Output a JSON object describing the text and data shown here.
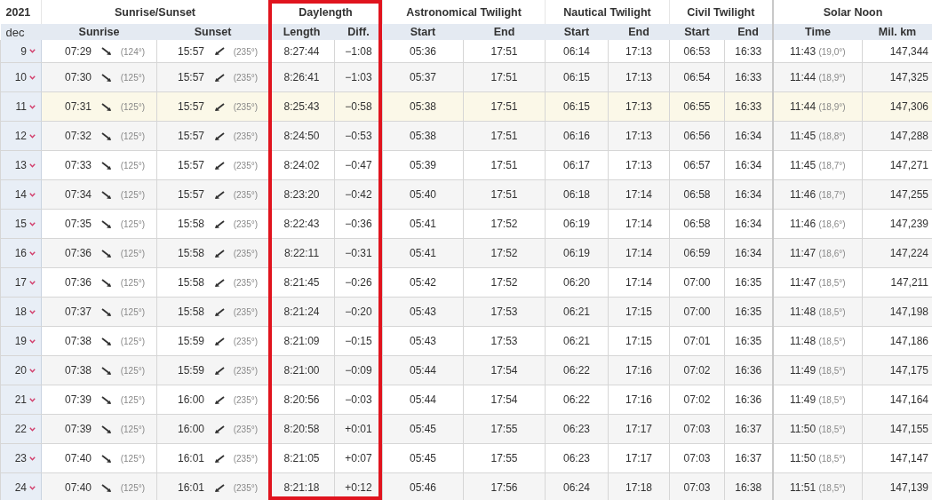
{
  "table": {
    "year": "2021",
    "month": "dec",
    "groups": [
      {
        "label": "Sunrise/Sunset",
        "highlighted": false
      },
      {
        "label": "Daylength",
        "highlighted": true
      },
      {
        "label": "Astronomical Twilight",
        "highlighted": false
      },
      {
        "label": "Nautical Twilight",
        "highlighted": false
      },
      {
        "label": "Civil Twilight",
        "highlighted": false
      },
      {
        "label": "Solar Noon",
        "highlighted": false
      }
    ],
    "columns": [
      "Sunrise",
      "Sunset",
      "Length",
      "Diff.",
      "Start",
      "End",
      "Start",
      "End",
      "Start",
      "End",
      "Time",
      "Mil. km"
    ],
    "rows": [
      {
        "day": "9",
        "selected": false,
        "sunrise": "07:29",
        "sunrise_azimuth": "(124°)",
        "sunset": "15:57",
        "sunset_azimuth": "(235°)",
        "length": "8:27:44",
        "diff": "−1:08",
        "astronomical_start": "05:36",
        "astronomical_end": "17:51",
        "nautical_start": "06:14",
        "nautical_end": "17:13",
        "civil_start": "06:53",
        "civil_end": "16:33",
        "noon": "11:43",
        "noon_altitude": "(19,0°)",
        "distance": "147,344"
      },
      {
        "day": "10",
        "selected": false,
        "sunrise": "07:30",
        "sunrise_azimuth": "(125°)",
        "sunset": "15:57",
        "sunset_azimuth": "(235°)",
        "length": "8:26:41",
        "diff": "−1:03",
        "astronomical_start": "05:37",
        "astronomical_end": "17:51",
        "nautical_start": "06:15",
        "nautical_end": "17:13",
        "civil_start": "06:54",
        "civil_end": "16:33",
        "noon": "11:44",
        "noon_altitude": "(18,9°)",
        "distance": "147,325"
      },
      {
        "day": "11",
        "selected": true,
        "sunrise": "07:31",
        "sunrise_azimuth": "(125°)",
        "sunset": "15:57",
        "sunset_azimuth": "(235°)",
        "length": "8:25:43",
        "diff": "−0:58",
        "astronomical_start": "05:38",
        "astronomical_end": "17:51",
        "nautical_start": "06:15",
        "nautical_end": "17:13",
        "civil_start": "06:55",
        "civil_end": "16:33",
        "noon": "11:44",
        "noon_altitude": "(18,9°)",
        "distance": "147,306"
      },
      {
        "day": "12",
        "selected": false,
        "sunrise": "07:32",
        "sunrise_azimuth": "(125°)",
        "sunset": "15:57",
        "sunset_azimuth": "(235°)",
        "length": "8:24:50",
        "diff": "−0:53",
        "astronomical_start": "05:38",
        "astronomical_end": "17:51",
        "nautical_start": "06:16",
        "nautical_end": "17:13",
        "civil_start": "06:56",
        "civil_end": "16:34",
        "noon": "11:45",
        "noon_altitude": "(18,8°)",
        "distance": "147,288"
      },
      {
        "day": "13",
        "selected": false,
        "sunrise": "07:33",
        "sunrise_azimuth": "(125°)",
        "sunset": "15:57",
        "sunset_azimuth": "(235°)",
        "length": "8:24:02",
        "diff": "−0:47",
        "astronomical_start": "05:39",
        "astronomical_end": "17:51",
        "nautical_start": "06:17",
        "nautical_end": "17:13",
        "civil_start": "06:57",
        "civil_end": "16:34",
        "noon": "11:45",
        "noon_altitude": "(18,7°)",
        "distance": "147,271"
      },
      {
        "day": "14",
        "selected": false,
        "sunrise": "07:34",
        "sunrise_azimuth": "(125°)",
        "sunset": "15:57",
        "sunset_azimuth": "(235°)",
        "length": "8:23:20",
        "diff": "−0:42",
        "astronomical_start": "05:40",
        "astronomical_end": "17:51",
        "nautical_start": "06:18",
        "nautical_end": "17:14",
        "civil_start": "06:58",
        "civil_end": "16:34",
        "noon": "11:46",
        "noon_altitude": "(18,7°)",
        "distance": "147,255"
      },
      {
        "day": "15",
        "selected": false,
        "sunrise": "07:35",
        "sunrise_azimuth": "(125°)",
        "sunset": "15:58",
        "sunset_azimuth": "(235°)",
        "length": "8:22:43",
        "diff": "−0:36",
        "astronomical_start": "05:41",
        "astronomical_end": "17:52",
        "nautical_start": "06:19",
        "nautical_end": "17:14",
        "civil_start": "06:58",
        "civil_end": "16:34",
        "noon": "11:46",
        "noon_altitude": "(18,6°)",
        "distance": "147,239"
      },
      {
        "day": "16",
        "selected": false,
        "sunrise": "07:36",
        "sunrise_azimuth": "(125°)",
        "sunset": "15:58",
        "sunset_azimuth": "(235°)",
        "length": "8:22:11",
        "diff": "−0:31",
        "astronomical_start": "05:41",
        "astronomical_end": "17:52",
        "nautical_start": "06:19",
        "nautical_end": "17:14",
        "civil_start": "06:59",
        "civil_end": "16:34",
        "noon": "11:47",
        "noon_altitude": "(18,6°)",
        "distance": "147,224"
      },
      {
        "day": "17",
        "selected": false,
        "sunrise": "07:36",
        "sunrise_azimuth": "(125°)",
        "sunset": "15:58",
        "sunset_azimuth": "(235°)",
        "length": "8:21:45",
        "diff": "−0:26",
        "astronomical_start": "05:42",
        "astronomical_end": "17:52",
        "nautical_start": "06:20",
        "nautical_end": "17:14",
        "civil_start": "07:00",
        "civil_end": "16:35",
        "noon": "11:47",
        "noon_altitude": "(18,5°)",
        "distance": "147,211"
      },
      {
        "day": "18",
        "selected": false,
        "sunrise": "07:37",
        "sunrise_azimuth": "(125°)",
        "sunset": "15:58",
        "sunset_azimuth": "(235°)",
        "length": "8:21:24",
        "diff": "−0:20",
        "astronomical_start": "05:43",
        "astronomical_end": "17:53",
        "nautical_start": "06:21",
        "nautical_end": "17:15",
        "civil_start": "07:00",
        "civil_end": "16:35",
        "noon": "11:48",
        "noon_altitude": "(18,5°)",
        "distance": "147,198"
      },
      {
        "day": "19",
        "selected": false,
        "sunrise": "07:38",
        "sunrise_azimuth": "(125°)",
        "sunset": "15:59",
        "sunset_azimuth": "(235°)",
        "length": "8:21:09",
        "diff": "−0:15",
        "astronomical_start": "05:43",
        "astronomical_end": "17:53",
        "nautical_start": "06:21",
        "nautical_end": "17:15",
        "civil_start": "07:01",
        "civil_end": "16:35",
        "noon": "11:48",
        "noon_altitude": "(18,5°)",
        "distance": "147,186"
      },
      {
        "day": "20",
        "selected": false,
        "sunrise": "07:38",
        "sunrise_azimuth": "(125°)",
        "sunset": "15:59",
        "sunset_azimuth": "(235°)",
        "length": "8:21:00",
        "diff": "−0:09",
        "astronomical_start": "05:44",
        "astronomical_end": "17:54",
        "nautical_start": "06:22",
        "nautical_end": "17:16",
        "civil_start": "07:02",
        "civil_end": "16:36",
        "noon": "11:49",
        "noon_altitude": "(18,5°)",
        "distance": "147,175"
      },
      {
        "day": "21",
        "selected": false,
        "sunrise": "07:39",
        "sunrise_azimuth": "(125°)",
        "sunset": "16:00",
        "sunset_azimuth": "(235°)",
        "length": "8:20:56",
        "diff": "−0:03",
        "astronomical_start": "05:44",
        "astronomical_end": "17:54",
        "nautical_start": "06:22",
        "nautical_end": "17:16",
        "civil_start": "07:02",
        "civil_end": "16:36",
        "noon": "11:49",
        "noon_altitude": "(18,5°)",
        "distance": "147,164"
      },
      {
        "day": "22",
        "selected": false,
        "sunrise": "07:39",
        "sunrise_azimuth": "(125°)",
        "sunset": "16:00",
        "sunset_azimuth": "(235°)",
        "length": "8:20:58",
        "diff": "+0:01",
        "astronomical_start": "05:45",
        "astronomical_end": "17:55",
        "nautical_start": "06:23",
        "nautical_end": "17:17",
        "civil_start": "07:03",
        "civil_end": "16:37",
        "noon": "11:50",
        "noon_altitude": "(18,5°)",
        "distance": "147,155"
      },
      {
        "day": "23",
        "selected": false,
        "sunrise": "07:40",
        "sunrise_azimuth": "(125°)",
        "sunset": "16:01",
        "sunset_azimuth": "(235°)",
        "length": "8:21:05",
        "diff": "+0:07",
        "astronomical_start": "05:45",
        "astronomical_end": "17:55",
        "nautical_start": "06:23",
        "nautical_end": "17:17",
        "civil_start": "07:03",
        "civil_end": "16:37",
        "noon": "11:50",
        "noon_altitude": "(18,5°)",
        "distance": "147,147"
      },
      {
        "day": "24",
        "selected": false,
        "sunrise": "07:40",
        "sunrise_azimuth": "(125°)",
        "sunset": "16:01",
        "sunset_azimuth": "(235°)",
        "length": "8:21:18",
        "diff": "+0:12",
        "astronomical_start": "05:46",
        "astronomical_end": "17:56",
        "nautical_start": "06:24",
        "nautical_end": "17:18",
        "civil_start": "07:03",
        "civil_end": "16:38",
        "noon": "11:51",
        "noon_altitude": "(18,5°)",
        "distance": "147,139"
      }
    ]
  }
}
